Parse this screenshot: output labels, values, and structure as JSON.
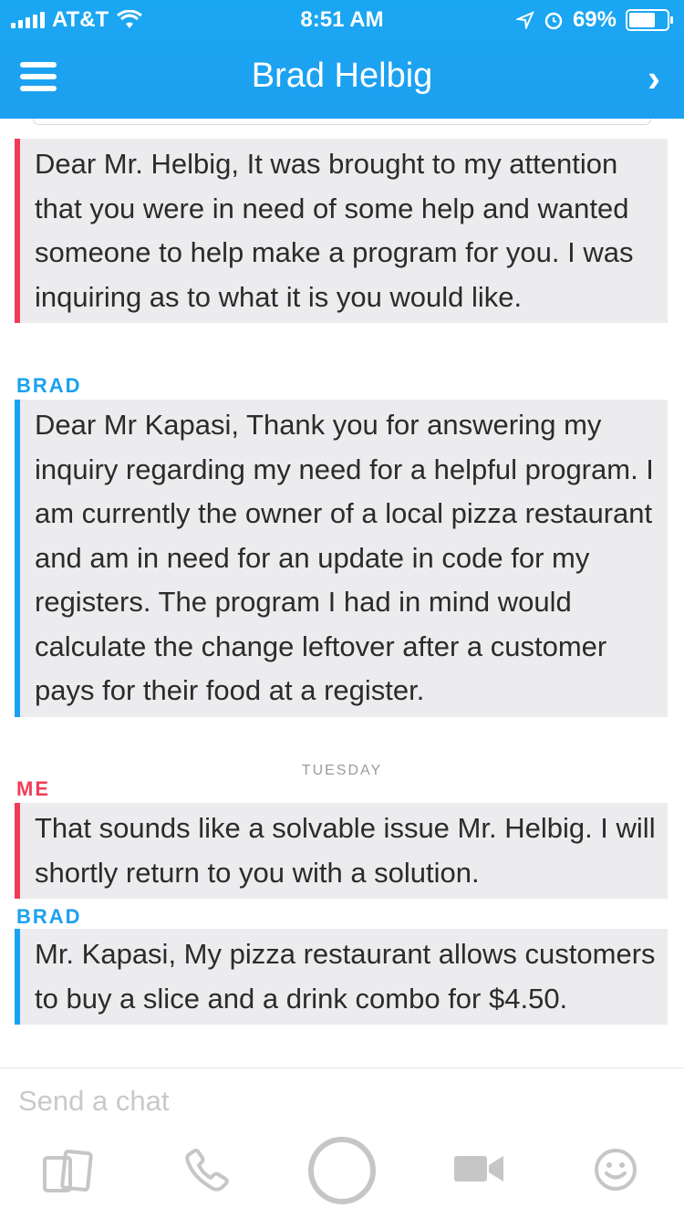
{
  "status_bar": {
    "carrier": "AT&T",
    "time": "8:51 AM",
    "battery": "69%"
  },
  "nav": {
    "title": "Brad Helbig"
  },
  "messages": [
    {
      "sender": "",
      "text": "Dear Mr. Helbig, It was brought to my attention that you were in need of some help and wanted someone to help make a program for you. I was inquiring as to what it is you would like."
    },
    {
      "sender": "BRAD",
      "text": "Dear Mr Kapasi, Thank you for answering my inquiry regarding my need for a helpful program. I am currently the owner of a local pizza restaurant and am in need for an update in code for my registers. The program I had in mind would calculate the change leftover after a customer pays for their food at a register."
    },
    {
      "day": "TUESDAY",
      "sender": "ME",
      "text": "That sounds like a solvable issue Mr. Helbig. I will shortly return to you with a solution."
    },
    {
      "sender": "BRAD",
      "text": "Mr. Kapasi, My pizza restaurant allows customers to buy a slice and a drink combo for $4.50."
    }
  ],
  "composer": {
    "placeholder": "Send a chat"
  },
  "bottom_icons": [
    "cards-icon",
    "phone-icon",
    "capture-icon",
    "video-icon",
    "emoji-icon"
  ],
  "colors": {
    "header": "#1aa7f2",
    "me": "#f23c57",
    "brad": "#1aa1f1",
    "bubble": "#ececee"
  }
}
